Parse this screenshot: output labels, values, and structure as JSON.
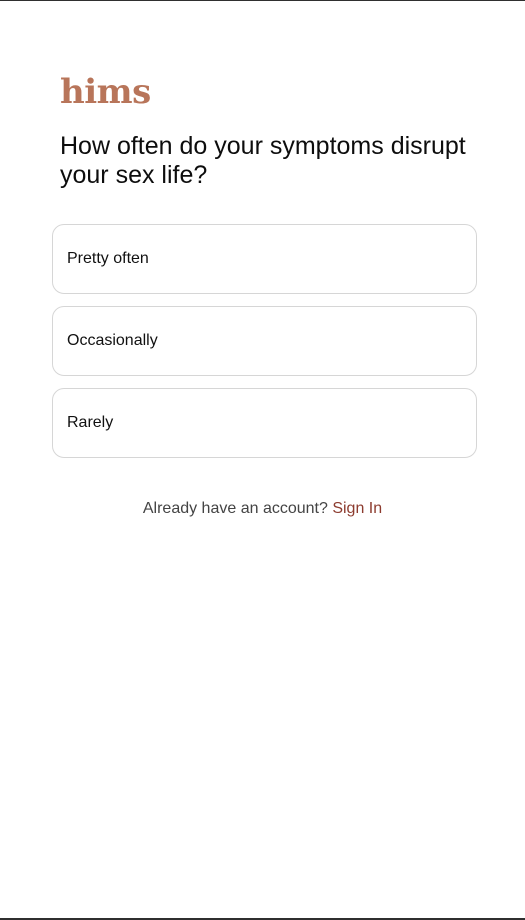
{
  "brand": {
    "logo_text": "hims",
    "logo_color": "#b8755a",
    "link_color": "#8c3b2e"
  },
  "question": {
    "title": "How often do your symptoms disrupt your sex life?"
  },
  "options": [
    {
      "label": "Pretty often"
    },
    {
      "label": "Occasionally"
    },
    {
      "label": "Rarely"
    }
  ],
  "account": {
    "prompt": "Already have an account?",
    "sign_in_label": "Sign In"
  }
}
